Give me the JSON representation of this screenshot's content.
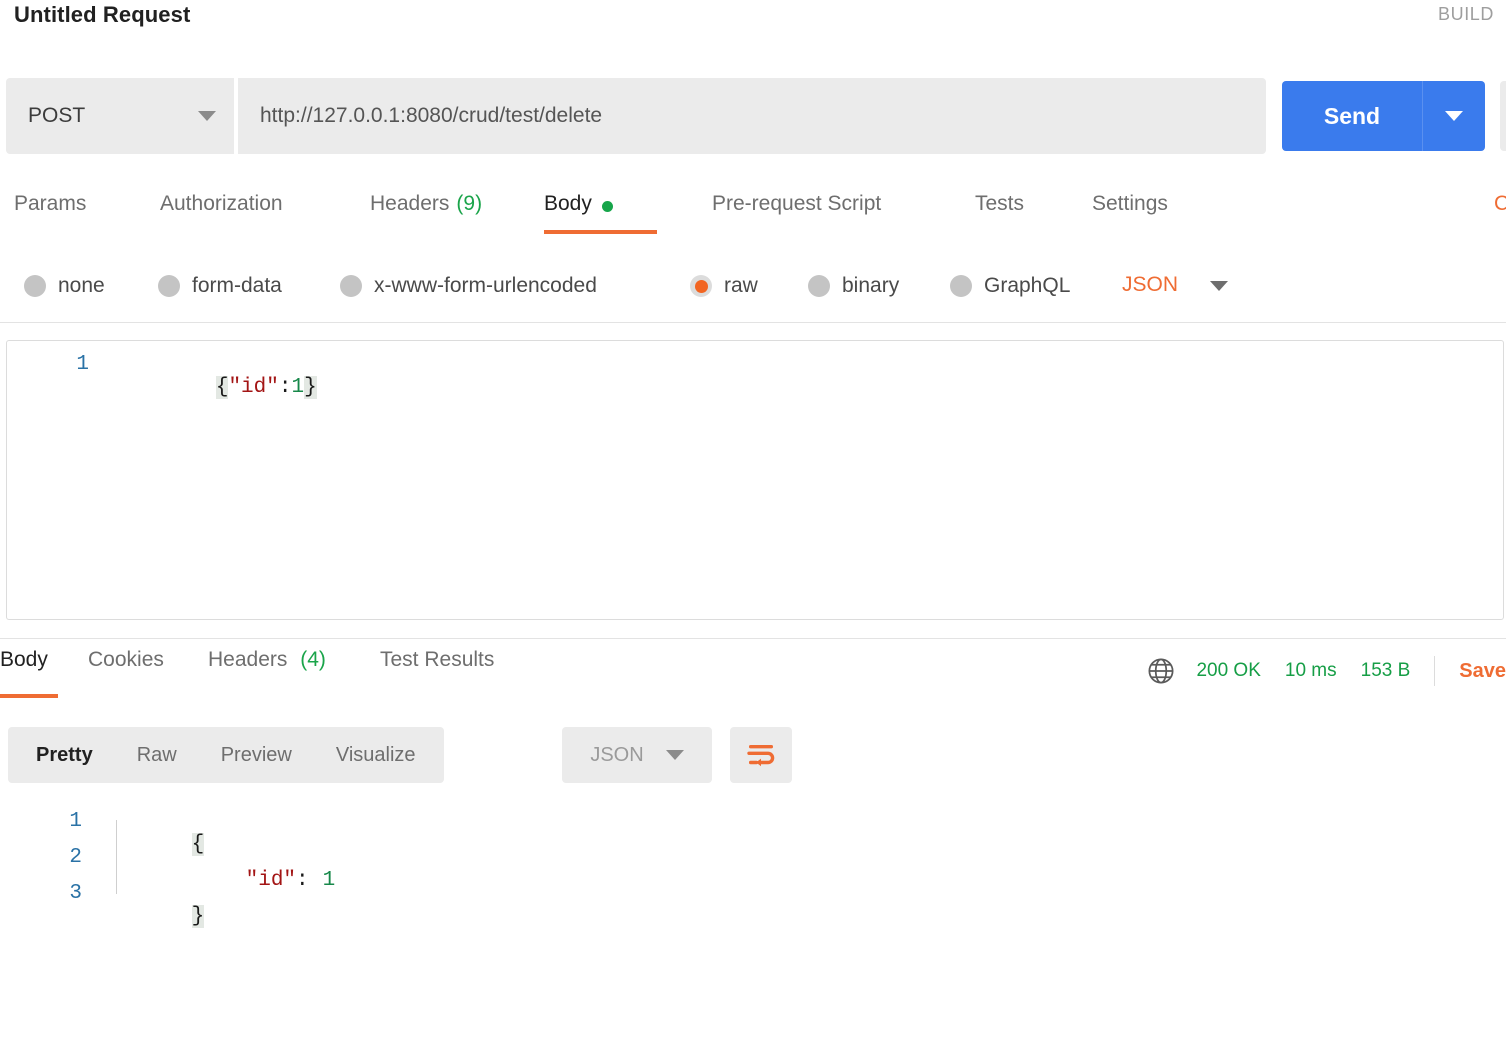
{
  "header": {
    "request_title": "Untitled Request",
    "build_label": "BUILD"
  },
  "url_bar": {
    "method": "POST",
    "method_caret_icon": "chevron-down-icon",
    "url": "http://127.0.0.1:8080/crud/test/delete",
    "send_label": "Send",
    "send_caret_icon": "chevron-down-icon"
  },
  "request_tabs": {
    "items": [
      {
        "label": "Params",
        "badge": "",
        "active": false
      },
      {
        "label": "Authorization",
        "badge": "",
        "active": false
      },
      {
        "label": "Headers",
        "badge": "(9)",
        "active": false
      },
      {
        "label": "Body",
        "badge": "",
        "active": true,
        "dot": true
      },
      {
        "label": "Pre-request Script",
        "badge": "",
        "active": false
      },
      {
        "label": "Tests",
        "badge": "",
        "active": false
      },
      {
        "label": "Settings",
        "badge": "",
        "active": false
      }
    ],
    "cookies_link": "Cookies"
  },
  "body_options": {
    "radios": [
      {
        "label": "none",
        "selected": false
      },
      {
        "label": "form-data",
        "selected": false
      },
      {
        "label": "x-www-form-urlencoded",
        "selected": false
      },
      {
        "label": "raw",
        "selected": true
      },
      {
        "label": "binary",
        "selected": false
      },
      {
        "label": "GraphQL",
        "selected": false
      }
    ],
    "content_type": "JSON",
    "content_type_caret_icon": "chevron-down-icon"
  },
  "request_body": {
    "language": "json",
    "lines": [
      {
        "number": "1",
        "open_brace": "{",
        "key": "\"id\"",
        "colon": ":",
        "value": "1",
        "close_brace": "}"
      }
    ],
    "raw_text": "{\"id\":1}"
  },
  "response_tabs": {
    "items": [
      {
        "label": "Body",
        "badge": "",
        "active": true
      },
      {
        "label": "Cookies",
        "badge": "",
        "active": false
      },
      {
        "label": "Headers",
        "badge": "(4)",
        "active": false
      },
      {
        "label": "Test Results",
        "badge": "",
        "active": false
      }
    ]
  },
  "response_status": {
    "globe_icon": "globe-icon",
    "status": "200 OK",
    "time": "10 ms",
    "size": "153 B",
    "save_label": "Save"
  },
  "response_toolbar": {
    "views": [
      {
        "label": "Pretty",
        "active": true
      },
      {
        "label": "Raw",
        "active": false
      },
      {
        "label": "Preview",
        "active": false
      },
      {
        "label": "Visualize",
        "active": false
      }
    ],
    "format": "JSON",
    "format_caret_icon": "chevron-down-icon",
    "wrap_icon": "word-wrap-icon"
  },
  "response_body": {
    "lines": [
      {
        "number": "1",
        "text": "{"
      },
      {
        "number": "2",
        "text": "\"id\": 1"
      },
      {
        "number": "3",
        "text": "}"
      }
    ],
    "line1_brace": "{",
    "line2_key": "\"id\"",
    "line2_colon": ":",
    "line2_value": "1",
    "line3_brace": "}"
  },
  "colors": {
    "accent_orange": "#ef6c33",
    "send_blue": "#3a7bed",
    "success_green": "#169e46",
    "json_key_red": "#a31515",
    "json_number_green": "#17884a",
    "line_number_blue": "#2a72a6"
  }
}
